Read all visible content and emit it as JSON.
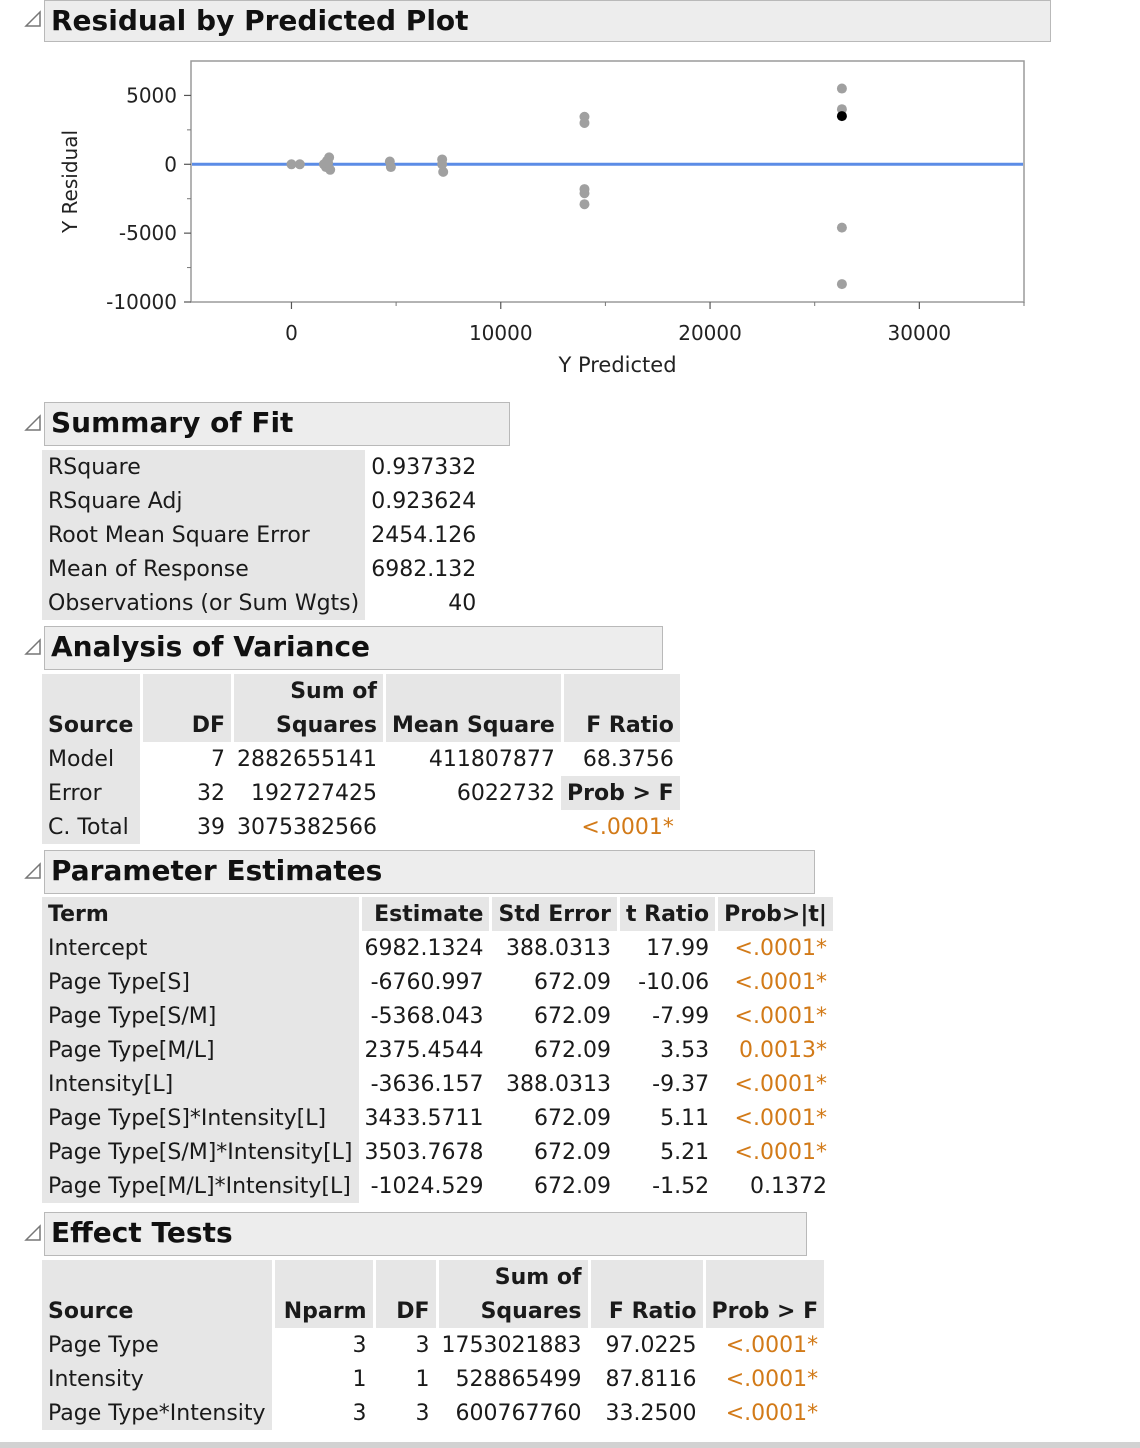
{
  "residual_plot": {
    "title": "Residual by Predicted Plot",
    "chart_data": {
      "type": "scatter",
      "title": "",
      "xlabel": "Y Predicted",
      "ylabel": "Y Residual",
      "xlim": [
        -4800,
        35000
      ],
      "ylim": [
        -10000,
        7500
      ],
      "x_ticks": [
        "0",
        "10000",
        "20000",
        "30000"
      ],
      "y_ticks": [
        "5000",
        "0",
        "-5000",
        "-10000"
      ],
      "reference_line_y": 0,
      "reference_line_color": "#5b8ce6",
      "point_color": "#a0a0a0",
      "highlight_color": "#000000",
      "points": [
        {
          "x": 0,
          "y": 0
        },
        {
          "x": 400,
          "y": 0
        },
        {
          "x": 1550,
          "y": 0
        },
        {
          "x": 1650,
          "y": -200
        },
        {
          "x": 1750,
          "y": 100
        },
        {
          "x": 1800,
          "y": 500
        },
        {
          "x": 1850,
          "y": -400
        },
        {
          "x": 1700,
          "y": 250
        },
        {
          "x": 4700,
          "y": 200
        },
        {
          "x": 4750,
          "y": -200
        },
        {
          "x": 7200,
          "y": 350
        },
        {
          "x": 7250,
          "y": -550
        },
        {
          "x": 7200,
          "y": 0
        },
        {
          "x": 14000,
          "y": 3450
        },
        {
          "x": 14000,
          "y": 3000
        },
        {
          "x": 14000,
          "y": -1800
        },
        {
          "x": 14000,
          "y": -2100
        },
        {
          "x": 14000,
          "y": -2900
        },
        {
          "x": 26300,
          "y": 5500
        },
        {
          "x": 26300,
          "y": 4000
        },
        {
          "x": 26300,
          "y": -4600
        },
        {
          "x": 26300,
          "y": -8700
        }
      ],
      "highlight_points": [
        {
          "x": 26300,
          "y": 3500
        }
      ]
    }
  },
  "summary_of_fit": {
    "title": "Summary of Fit",
    "rows": [
      {
        "label": "RSquare",
        "value": "0.937332"
      },
      {
        "label": "RSquare Adj",
        "value": "0.923624"
      },
      {
        "label": "Root Mean Square Error",
        "value": "2454.126"
      },
      {
        "label": "Mean of Response",
        "value": "6982.132"
      },
      {
        "label": "Observations (or Sum Wgts)",
        "value": "40"
      }
    ]
  },
  "anova": {
    "title": "Analysis of Variance",
    "headers": {
      "source": "Source",
      "df": "DF",
      "ss_top": "Sum of",
      "ss_bottom": "Squares",
      "ms": "Mean Square",
      "f": "F Ratio",
      "prob": "Prob > F"
    },
    "rows": [
      {
        "source": "Model",
        "df": "7",
        "ss": "2882655141",
        "ms": "411807877",
        "f": "68.3756"
      },
      {
        "source": "Error",
        "df": "32",
        "ss": "192727425",
        "ms": "6022732"
      },
      {
        "source": "C. Total",
        "df": "39",
        "ss": "3075382566",
        "prob": "<.0001*"
      }
    ]
  },
  "parameter_estimates": {
    "title": "Parameter Estimates",
    "headers": {
      "term": "Term",
      "estimate": "Estimate",
      "se": "Std Error",
      "t": "t Ratio",
      "p": "Prob>|t|"
    },
    "rows": [
      {
        "term": "Intercept",
        "estimate": "6982.1324",
        "se": "388.0313",
        "t": "17.99",
        "p": "<.0001*",
        "sig": true
      },
      {
        "term": "Page Type[S]",
        "estimate": "-6760.997",
        "se": "672.09",
        "t": "-10.06",
        "p": "<.0001*",
        "sig": true
      },
      {
        "term": "Page Type[S/M]",
        "estimate": "-5368.043",
        "se": "672.09",
        "t": "-7.99",
        "p": "<.0001*",
        "sig": true
      },
      {
        "term": "Page Type[M/L]",
        "estimate": "2375.4544",
        "se": "672.09",
        "t": "3.53",
        "p": "0.0013*",
        "sig": true
      },
      {
        "term": "Intensity[L]",
        "estimate": "-3636.157",
        "se": "388.0313",
        "t": "-9.37",
        "p": "<.0001*",
        "sig": true
      },
      {
        "term": "Page Type[S]*Intensity[L]",
        "estimate": "3433.5711",
        "se": "672.09",
        "t": "5.11",
        "p": "<.0001*",
        "sig": true
      },
      {
        "term": "Page Type[S/M]*Intensity[L]",
        "estimate": "3503.7678",
        "se": "672.09",
        "t": "5.21",
        "p": "<.0001*",
        "sig": true
      },
      {
        "term": "Page Type[M/L]*Intensity[L]",
        "estimate": "-1024.529",
        "se": "672.09",
        "t": "-1.52",
        "p": "0.1372",
        "sig": false
      }
    ]
  },
  "effect_tests": {
    "title": "Effect Tests",
    "headers": {
      "source": "Source",
      "nparm": "Nparm",
      "df": "DF",
      "ss_top": "Sum of",
      "ss_bottom": "Squares",
      "f": "F Ratio",
      "p": "Prob > F"
    },
    "rows": [
      {
        "source": "Page Type",
        "nparm": "3",
        "df": "3",
        "ss": "1753021883",
        "f": "97.0225",
        "p": "<.0001*"
      },
      {
        "source": "Intensity",
        "nparm": "1",
        "df": "1",
        "ss": "528865499",
        "f": "87.8116",
        "p": "<.0001*"
      },
      {
        "source": "Page Type*Intensity",
        "nparm": "3",
        "df": "3",
        "ss": "600767760",
        "f": "33.2500",
        "p": "<.0001*"
      }
    ]
  },
  "colors": {
    "significant": "#d27a18",
    "header_bg": "#ededed",
    "label_bg": "#e6e6e6"
  }
}
